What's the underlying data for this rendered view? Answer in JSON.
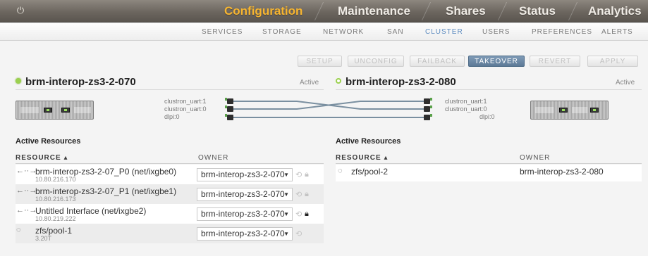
{
  "topnav": {
    "power_icon": "power-icon",
    "items": [
      "Configuration",
      "Maintenance",
      "Shares",
      "Status",
      "Analytics"
    ],
    "active": "Configuration"
  },
  "subnav": {
    "items": [
      "SERVICES",
      "STORAGE",
      "NETWORK",
      "SAN",
      "CLUSTER",
      "USERS",
      "PREFERENCES",
      "ALERTS"
    ],
    "active": "CLUSTER"
  },
  "actions": [
    "SETUP",
    "UNCONFIG",
    "FAILBACK",
    "TAKEOVER",
    "REVERT",
    "APPLY"
  ],
  "nodes": [
    {
      "name": "brm-interop-zs3-2-070",
      "status": "Active",
      "interfaces": [
        "clustron_uart:1",
        "clustron_uart:0",
        "dlpi:0"
      ]
    },
    {
      "name": "brm-interop-zs3-2-080",
      "status": "Active",
      "interfaces": [
        "clustron_uart:1",
        "clustron_uart:0",
        "dlpi:0"
      ]
    }
  ],
  "resources_left": {
    "title": "Active Resources",
    "col_resource": "RESOURCE ▴",
    "col_owner": "OWNER",
    "rows": [
      {
        "icon": "←··→",
        "name": "brm-interop-zs3-2-07_P0 (net/ixgbe0)",
        "sub": "10.80.216.170",
        "owner": "brm-interop-zs3-2-070"
      },
      {
        "icon": "←··→",
        "name": "brm-interop-zs3-2-07_P1 (net/ixgbe1)",
        "sub": "10.80.216.173",
        "owner": "brm-interop-zs3-2-070"
      },
      {
        "icon": "←··→",
        "name": "Untitled Interface (net/ixgbe2)",
        "sub": "10.80.219.222",
        "owner": "brm-interop-zs3-2-070"
      },
      {
        "icon": "◌",
        "name": "zfs/pool-1",
        "sub": "3.20T",
        "owner": "brm-interop-zs3-2-070"
      }
    ]
  },
  "resources_right": {
    "title": "Active Resources",
    "col_resource": "RESOURCE ▴",
    "col_owner": "OWNER",
    "rows": [
      {
        "icon": "◌",
        "name": "zfs/pool-2",
        "owner": "brm-interop-zs3-2-080"
      }
    ]
  },
  "colors": {
    "accent_active": "#f7b530",
    "subnav_active": "#5d8cc0",
    "status_led": "#9bd04f",
    "primary_button": "#5c7996"
  }
}
